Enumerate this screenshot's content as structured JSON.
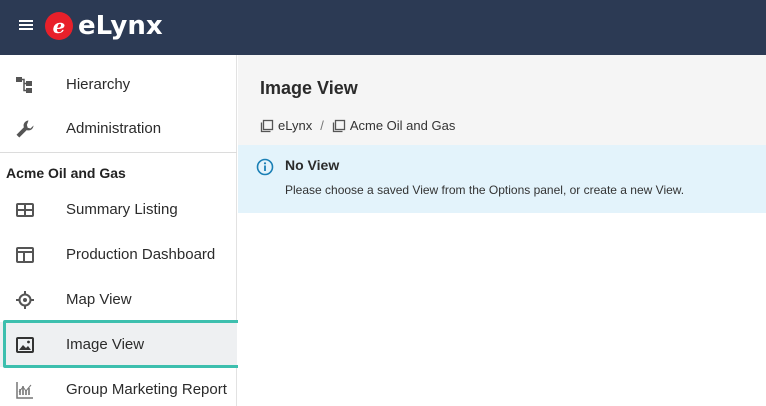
{
  "app": {
    "brand_mark": "e",
    "brand_name": "eLynx"
  },
  "sidebar": {
    "top_items": [
      {
        "label": "Hierarchy",
        "icon": "hierarchy-icon"
      },
      {
        "label": "Administration",
        "icon": "wrench-icon"
      }
    ],
    "section_label": "Acme Oil and Gas",
    "items": [
      {
        "label": "Summary Listing",
        "icon": "table-icon"
      },
      {
        "label": "Production Dashboard",
        "icon": "dashboard-icon"
      },
      {
        "label": "Map View",
        "icon": "map-target-icon"
      },
      {
        "label": "Image View",
        "icon": "image-icon",
        "active": true
      },
      {
        "label": "Group Marketing Report",
        "icon": "report-chart-icon"
      }
    ]
  },
  "main": {
    "title": "Image View",
    "breadcrumb": [
      {
        "label": "eLynx",
        "icon": "copy-icon"
      },
      {
        "label": "Acme Oil and Gas",
        "icon": "copy-icon"
      }
    ],
    "breadcrumb_separator": "/",
    "notice": {
      "icon": "info-icon",
      "title": "No View",
      "message": "Please choose a saved View from the Options panel, or create a new View."
    }
  },
  "colors": {
    "topbar": "#2c3a54",
    "brand_red": "#e8202a",
    "highlight": "#3dbfae",
    "info_bg": "#e3f3fb",
    "info_icon": "#1a7fb5"
  }
}
